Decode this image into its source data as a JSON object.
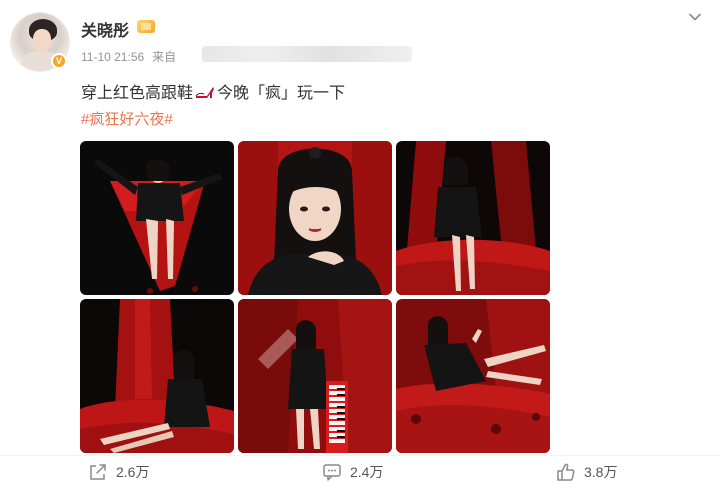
{
  "post": {
    "username": "关晓彤",
    "time": "11-10 21:56",
    "source_prefix": "来自",
    "text_before": "穿上红色高跟鞋",
    "text_after": "今晚「疯」玩一下",
    "hashtag": "#疯狂好六夜#",
    "verified_badge": "V"
  },
  "icons": {
    "more": "chevron-down-icon",
    "heel": "high-heel-emoji",
    "share": "share-icon",
    "comment": "comment-icon",
    "like": "like-icon"
  },
  "actions": {
    "share_count": "2.6万",
    "comment_count": "2.4万",
    "like_count": "3.8万"
  },
  "colors": {
    "hashtag": "#eb7350",
    "accent_red": "#c81a1a",
    "vip_gold": "#f5a623"
  }
}
